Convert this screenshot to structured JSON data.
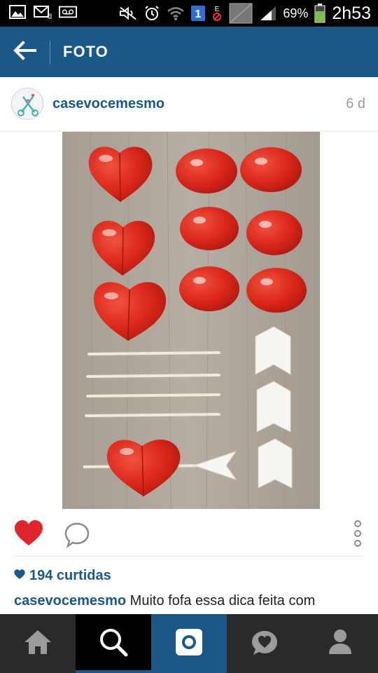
{
  "status_bar": {
    "battery": "69%",
    "time": "2h53",
    "sim_badge": "1",
    "icons": [
      "image-icon",
      "email-icon",
      "voicemail-icon",
      "mute-icon",
      "alarm-icon",
      "wifi-icon",
      "sim-icon",
      "no-data-icon",
      "signal-icon",
      "battery-icon"
    ]
  },
  "header": {
    "title": "FOTO",
    "back_icon": "arrow-left-icon"
  },
  "post": {
    "username": "casevocemesmo",
    "time_ago": "6 d",
    "likes": "194 curtidas",
    "caption_user": "casevocemesmo",
    "caption_text": "Muito fofa essa dica feita com"
  },
  "actions": {
    "like_icon": "heart-icon",
    "comment_icon": "comment-bubble-icon",
    "more_icon": "vertical-dots-icon"
  },
  "bottom_nav": {
    "items": [
      "home-icon",
      "search-icon",
      "camera-icon",
      "activity-heart-icon",
      "profile-icon"
    ]
  },
  "colors": {
    "brand_blue": "#1b5887",
    "like_red": "#e0262d",
    "nav_dark": "#2a2a2a"
  }
}
